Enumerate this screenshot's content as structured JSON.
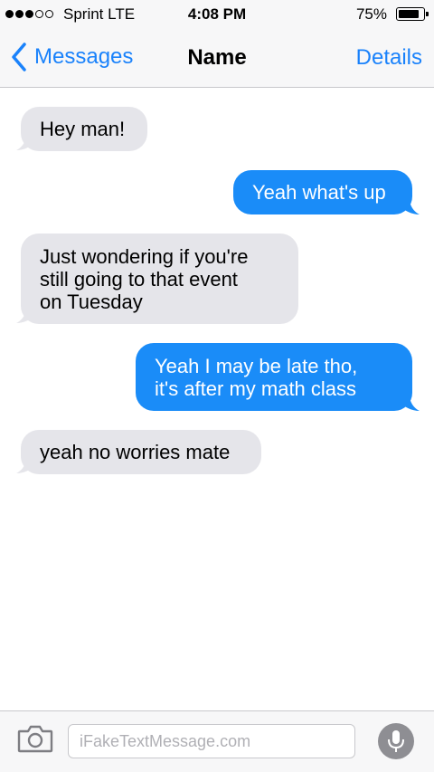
{
  "status_bar": {
    "signal_bars_filled": 3,
    "signal_bars_total": 5,
    "carrier": "Sprint  LTE",
    "time": "4:08 PM",
    "battery_percent": "75%"
  },
  "nav": {
    "back_label": "Messages",
    "title": "Name",
    "details_label": "Details"
  },
  "messages": [
    {
      "direction": "incoming",
      "text": "Hey man!"
    },
    {
      "direction": "outgoing",
      "text": "Yeah what's up"
    },
    {
      "direction": "incoming",
      "text": "Just wondering if you're\nstill going to that event\non Tuesday"
    },
    {
      "direction": "outgoing",
      "text": "Yeah I may be late tho,\nit's after my math class"
    },
    {
      "direction": "incoming",
      "text": "yeah no worries mate"
    }
  ],
  "compose": {
    "placeholder": "iFakeTextMessage.com",
    "value": ""
  },
  "icons": {
    "back": "chevron-left-icon",
    "camera": "camera-icon",
    "mic": "microphone-icon",
    "battery": "battery-icon",
    "signal": "signal-dots-icon"
  },
  "colors": {
    "accent": "#1a82fb",
    "outgoing_bubble": "#1a8cf8",
    "incoming_bubble": "#e5e5ea",
    "bar_background": "#f7f7f8"
  }
}
